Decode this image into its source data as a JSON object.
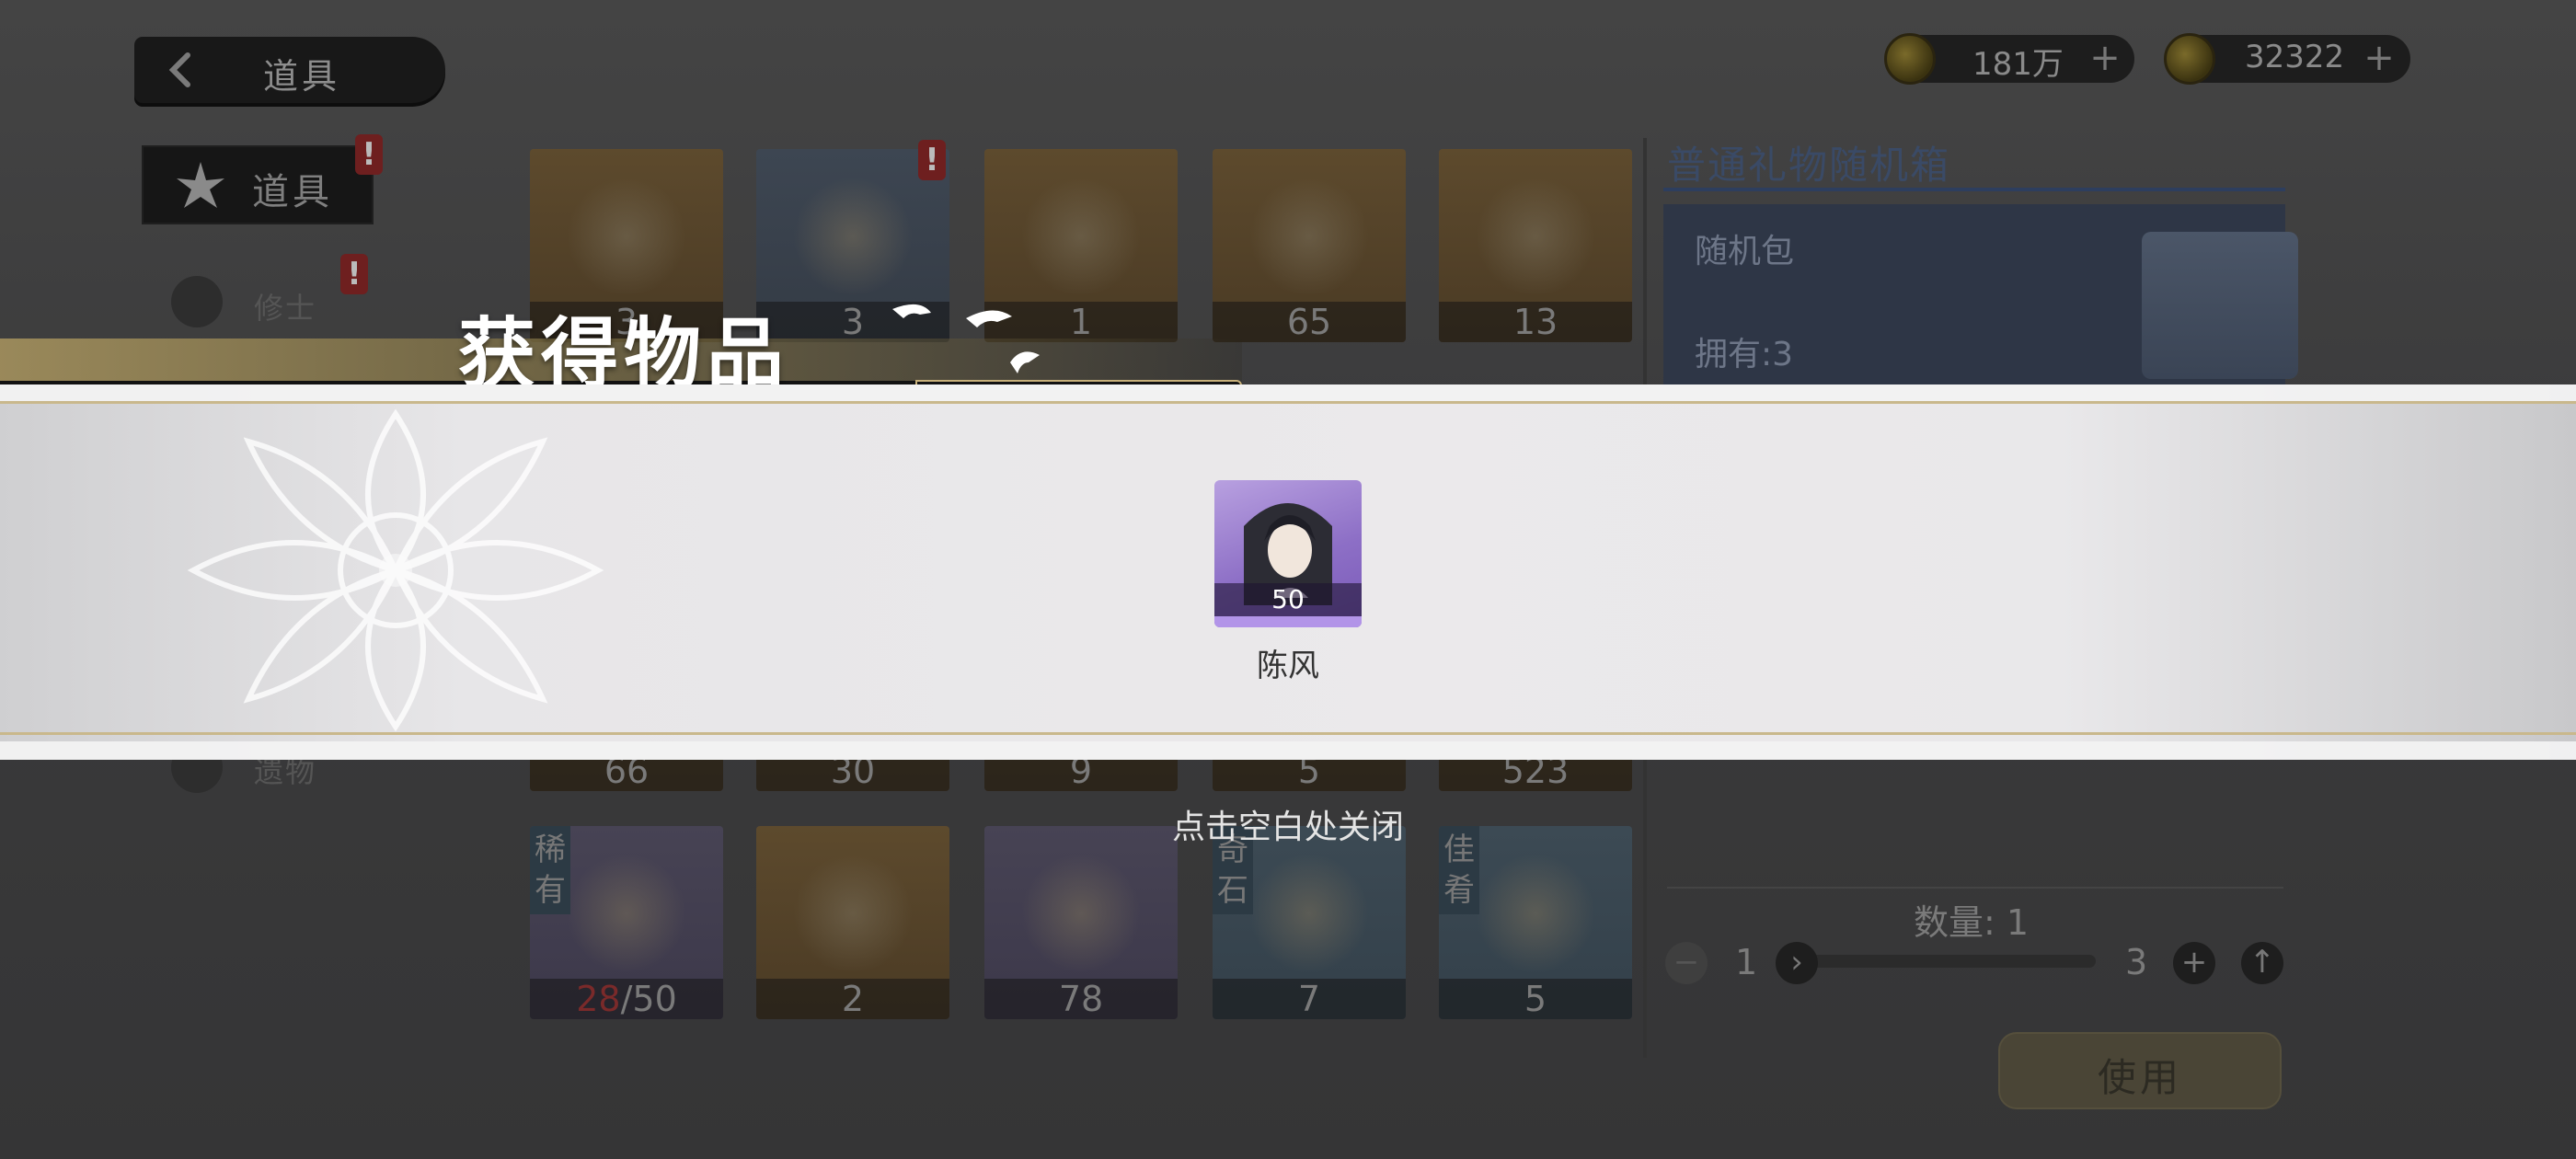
{
  "header": {
    "back_title": "道具",
    "currencies": [
      {
        "icon": "copper-coin-icon",
        "amount": "181万"
      },
      {
        "icon": "jade-currency-icon",
        "amount": "32322"
      }
    ]
  },
  "sidebar": {
    "items": [
      {
        "label": "道具",
        "active": true,
        "alert": "!"
      },
      {
        "label": "修士",
        "alert": "!"
      },
      {
        "label": "遗物"
      }
    ]
  },
  "inventory": {
    "row1": [
      {
        "count": "3"
      },
      {
        "count": "3"
      },
      {
        "count": "1"
      },
      {
        "count": "65"
      },
      {
        "count": "13"
      }
    ],
    "row3": [
      {
        "count": "66"
      },
      {
        "count": "30"
      },
      {
        "count": "9"
      },
      {
        "count": "5"
      },
      {
        "count": "523"
      }
    ],
    "row4": [
      {
        "tag": "稀有",
        "count_current": "28",
        "count_total": "/50"
      },
      {
        "count": "2"
      },
      {
        "count": "78"
      },
      {
        "tag": "奇石",
        "count": "7"
      },
      {
        "tag": "佳肴",
        "count": "5"
      }
    ],
    "alert_mark": "!"
  },
  "detail": {
    "title": "普通礼物随机箱",
    "type": "随机包",
    "owned": "拥有:3",
    "quantity_label": "数量:",
    "quantity_value": "1",
    "min": "1",
    "max": "3",
    "use_label": "使用"
  },
  "overlay": {
    "title": "获得物品",
    "reward": {
      "name": "陈风",
      "count": "50"
    },
    "close_hint": "点击空白处关闭"
  },
  "colors": {
    "band": "#ebe9eb",
    "gold": "#c9b88c",
    "reward_bg": "#8d6fc6"
  }
}
